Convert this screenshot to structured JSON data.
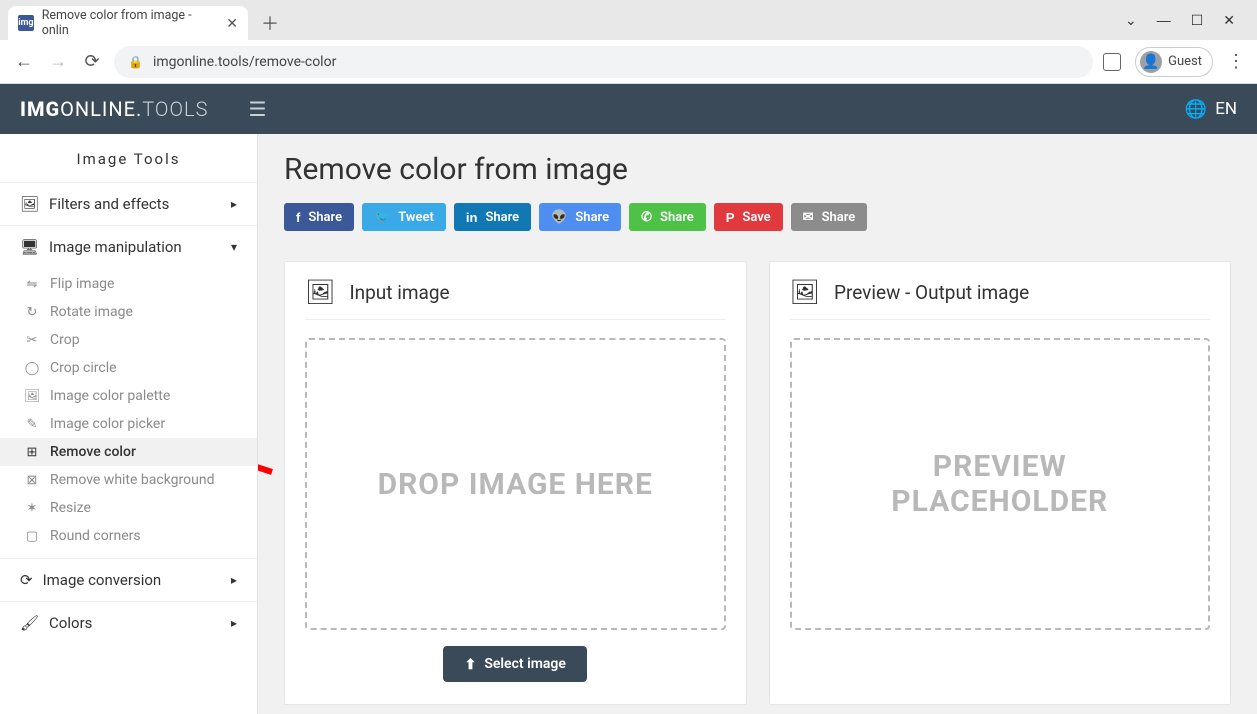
{
  "browser": {
    "tab_title": "Remove color from image - onlin",
    "url": "imgonline.tools/remove-color",
    "guest_label": "Guest",
    "window": {
      "min": "—",
      "max": "☐",
      "close": "✕",
      "chevron": "⌄"
    }
  },
  "header": {
    "logo_bold": "IMG",
    "logo_mid": "ONLINE.",
    "logo_light": "TOOLS",
    "lang": "EN"
  },
  "sidebar": {
    "title": "Image Tools",
    "categories": [
      {
        "label": "Filters and effects",
        "expanded": false
      },
      {
        "label": "Image manipulation",
        "expanded": true
      },
      {
        "label": "Image conversion",
        "expanded": false
      },
      {
        "label": "Colors",
        "expanded": false
      }
    ],
    "manipulation_items": [
      {
        "icon": "⇋",
        "label": "Flip image"
      },
      {
        "icon": "↻",
        "label": "Rotate image"
      },
      {
        "icon": "✂",
        "label": "Crop"
      },
      {
        "icon": "◯",
        "label": "Crop circle"
      },
      {
        "icon": "🖼",
        "label": "Image color palette"
      },
      {
        "icon": "✎",
        "label": "Image color picker"
      },
      {
        "icon": "⊞",
        "label": "Remove color",
        "selected": true
      },
      {
        "icon": "⊠",
        "label": "Remove white background"
      },
      {
        "icon": "✶",
        "label": "Resize"
      },
      {
        "icon": "▢",
        "label": "Round corners"
      }
    ]
  },
  "page": {
    "title": "Remove color from image",
    "share": {
      "facebook": "Share",
      "twitter": "Tweet",
      "linkedin": "Share",
      "reddit": "Share",
      "whatsapp": "Share",
      "pinterest": "Save",
      "email": "Share"
    },
    "input_panel": {
      "title": "Input image",
      "drop_text": "DROP IMAGE HERE",
      "select_button": "Select image"
    },
    "output_panel": {
      "title": "Preview - Output image",
      "placeholder_line1": "PREVIEW",
      "placeholder_line2": "PLACEHOLDER"
    }
  }
}
